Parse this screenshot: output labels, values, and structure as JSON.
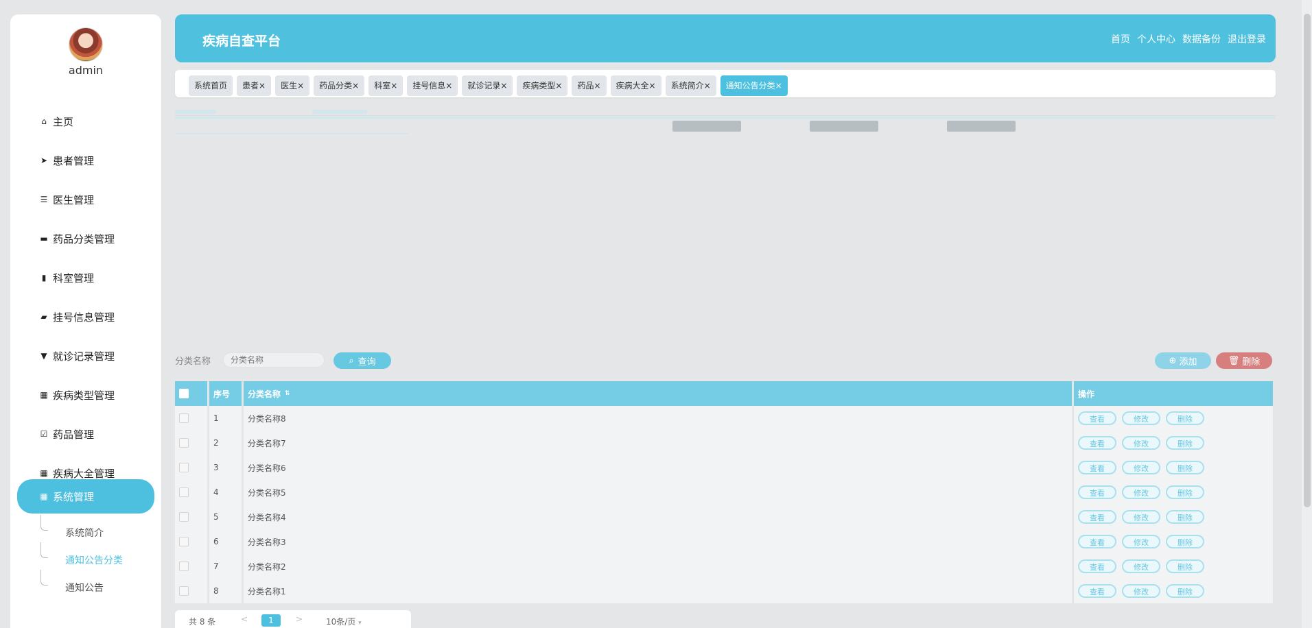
{
  "user": {
    "name": "admin"
  },
  "sidebar": {
    "items": [
      {
        "label": "主页",
        "icon": "home-icon"
      },
      {
        "label": "患者管理",
        "icon": "send-icon"
      },
      {
        "label": "医生管理",
        "icon": "list-icon"
      },
      {
        "label": "药品分类管理",
        "icon": "briefcase-icon"
      },
      {
        "label": "科室管理",
        "icon": "clipboard-icon"
      },
      {
        "label": "挂号信息管理",
        "icon": "wallet-icon"
      },
      {
        "label": "就诊记录管理",
        "icon": "sign-icon"
      },
      {
        "label": "疾病类型管理",
        "icon": "grid-icon"
      },
      {
        "label": "药品管理",
        "icon": "check-clipboard-icon"
      },
      {
        "label": "疾病大全管理",
        "icon": "grid-icon"
      },
      {
        "label": "系统管理",
        "icon": "grid-icon"
      }
    ],
    "submenu": [
      {
        "label": "系统简介"
      },
      {
        "label": "通知公告分类"
      },
      {
        "label": "通知公告"
      }
    ]
  },
  "header": {
    "title": "疾病自查平台",
    "links": [
      "首页",
      "个人中心",
      "数据备份",
      "退出登录"
    ]
  },
  "tabs": [
    {
      "label": "系统首页"
    },
    {
      "label": "患者×"
    },
    {
      "label": "医生×"
    },
    {
      "label": "药品分类×"
    },
    {
      "label": "科室×"
    },
    {
      "label": "挂号信息×"
    },
    {
      "label": "就诊记录×"
    },
    {
      "label": "疾病类型×"
    },
    {
      "label": "药品×"
    },
    {
      "label": "疾病大全×"
    },
    {
      "label": "系统简介×"
    },
    {
      "label": "通知公告分类×"
    }
  ],
  "search": {
    "label": "分类名称",
    "placeholder": "分类名称",
    "button": "查询"
  },
  "actions": {
    "add": "添加",
    "delete": "删除"
  },
  "table": {
    "headers": {
      "index": "序号",
      "name": "分类名称",
      "ops": "操作"
    },
    "rows": [
      {
        "index": "1",
        "name": "分类名称8"
      },
      {
        "index": "2",
        "name": "分类名称7"
      },
      {
        "index": "3",
        "name": "分类名称6"
      },
      {
        "index": "4",
        "name": "分类名称5"
      },
      {
        "index": "5",
        "name": "分类名称4"
      },
      {
        "index": "6",
        "name": "分类名称3"
      },
      {
        "index": "7",
        "name": "分类名称2"
      },
      {
        "index": "8",
        "name": "分类名称1"
      }
    ],
    "ops": {
      "view": "查看",
      "edit": "修改",
      "delete": "删除"
    }
  },
  "pager": {
    "total": "共 8 条",
    "prev": "<",
    "current": "1",
    "next": ">",
    "size": "10条/页"
  },
  "colors": {
    "accent": "#4dbfdf",
    "header": "#4fc1df",
    "danger": "#d77f7f"
  }
}
